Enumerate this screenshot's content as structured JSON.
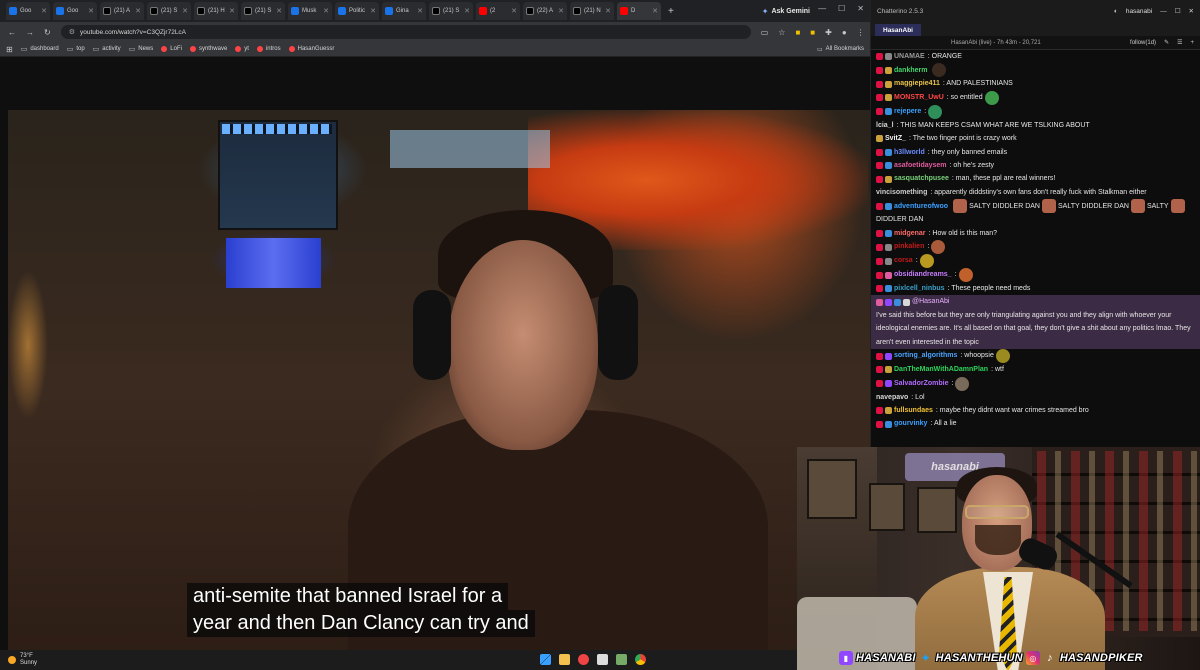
{
  "browser": {
    "tabs": [
      {
        "label": "Goo",
        "icon": "google-icon",
        "active": false
      },
      {
        "label": "Goo",
        "icon": "google-icon",
        "active": false
      },
      {
        "label": "(21) A",
        "icon": "x-icon",
        "active": false
      },
      {
        "label": "(21) S",
        "icon": "x-icon",
        "active": false
      },
      {
        "label": "(21) H",
        "icon": "x-icon",
        "active": false
      },
      {
        "label": "(21) S",
        "icon": "x-icon",
        "active": false
      },
      {
        "label": "Musk",
        "icon": "google-icon",
        "active": false
      },
      {
        "label": "Politic",
        "icon": "news-icon",
        "active": false
      },
      {
        "label": "Gina",
        "icon": "news-icon",
        "active": false
      },
      {
        "label": "(21) S",
        "icon": "x-icon",
        "active": false
      },
      {
        "label": "(2",
        "icon": "youtube-icon",
        "active": false
      },
      {
        "label": "(22) A",
        "icon": "x-icon",
        "active": false
      },
      {
        "label": "(21) N",
        "icon": "x-icon",
        "active": false
      },
      {
        "label": "D",
        "icon": "youtube-icon",
        "active": true
      }
    ],
    "new_tab_label": "+",
    "gemini_label": "Ask Gemini",
    "url": "youtube.com/watch?v=C3QZjr72LcA",
    "bookmarks": [
      {
        "label": "dashboard",
        "icon": "folder-icon"
      },
      {
        "label": "top",
        "icon": "folder-icon"
      },
      {
        "label": "activity",
        "icon": "folder-icon"
      },
      {
        "label": "News",
        "icon": "folder-icon"
      },
      {
        "label": "LoFi",
        "icon": "youtube-icon"
      },
      {
        "label": "synthwave",
        "icon": "youtube-icon"
      },
      {
        "label": "yt",
        "icon": "youtube-icon"
      },
      {
        "label": "intros",
        "icon": "youtube-icon"
      },
      {
        "label": "HasanGuessr",
        "icon": "youtube-icon"
      }
    ],
    "all_bookmarks_label": "All Bookmarks"
  },
  "video": {
    "captions": [
      "anti-semite that banned Israel for a",
      "year and then Dan Clancy can try and"
    ]
  },
  "taskbar": {
    "temperature": "73°F",
    "condition": "Sunny"
  },
  "chatterino": {
    "window_title": "Chatterino 2.5.3",
    "user": "hasanabi",
    "tab_label": "HasanAbi",
    "stream_info": "HasanAbi (live) - 7h 43m - 20,721",
    "follow_label": "follow(1d)",
    "messages": [
      {
        "user": "UNAMAE",
        "color": "#9a9a9a",
        "text": ": ORANGE",
        "badges": [
          "b-red",
          "b-grey"
        ],
        "emotes": []
      },
      {
        "user": "dankherm",
        "color": "#41d66a",
        "text": "",
        "badges": [
          "b-red",
          "b-gold"
        ],
        "emotes": [
          "#3a2a20"
        ]
      },
      {
        "user": "maggiepie411",
        "color": "#e8c44a",
        "text": ": AND PALESTINIANS",
        "badges": [
          "b-red",
          "b-gold"
        ],
        "emotes": []
      },
      {
        "user": "MONSTR_UwU",
        "color": "#ff4545",
        "text": ": so entitled",
        "badges": [
          "b-red",
          "b-gold"
        ],
        "emotes": [
          "#3c9a4a"
        ]
      },
      {
        "user": "rejepere",
        "color": "#3aa0ff",
        "text": ":",
        "badges": [
          "b-red",
          "b-blue"
        ],
        "emotes": [
          "#2f8f5a"
        ]
      },
      {
        "user": "lcia_l",
        "color": "#d8d8d8",
        "text": ": THIS MAN KEEPS CSAM WHAT ARE WE TSLKING ABOUT",
        "badges": [],
        "emotes": []
      },
      {
        "user": "SvitZ_",
        "color": "#f4f4f4",
        "text": ": The two finger point is crazy work",
        "badges": [
          "b-gold"
        ],
        "emotes": []
      },
      {
        "user": "h3llworld",
        "color": "#6b8cff",
        "text": ": they only banned emails",
        "badges": [
          "b-red",
          "b-blue"
        ],
        "emotes": []
      },
      {
        "user": "asafoetidaysem",
        "color": "#e05c9f",
        "text": ": oh he's zesty",
        "badges": [
          "b-red",
          "b-blue"
        ],
        "emotes": []
      },
      {
        "user": "sasquatchpusee",
        "color": "#7ad17a",
        "text": ": man, these ppl are real winners!",
        "badges": [
          "b-red",
          "b-gold"
        ],
        "emotes": []
      },
      {
        "user": "vincisomething",
        "color": "#cfcfcf",
        "text": ": apparently diddstiny's own fans don't really fuck with Stalkman either",
        "badges": [],
        "emotes": []
      }
    ],
    "multi_msg": {
      "user": "adventureofwoo",
      "color": "#3aa0ff",
      "parts": [
        "SALTY DIDDLER DAN",
        "SALTY DIDDLER DAN",
        "SALTY",
        "DIDDLER DAN"
      ]
    },
    "messages2": [
      {
        "user": "midgenar",
        "color": "#ff6a6a",
        "text": ": How old is this man?",
        "badges": [
          "b-red",
          "b-blue"
        ],
        "emotes": []
      },
      {
        "user": "pinkalien",
        "color": "#c41a1a",
        "text": ":",
        "badges": [
          "b-red",
          "b-grey"
        ],
        "emotes": [
          "#a85a3a"
        ]
      },
      {
        "user": "corsa",
        "color": "#c41a1a",
        "text": ":",
        "badges": [
          "b-red",
          "b-grey"
        ],
        "emotes": [
          "#b89a20"
        ]
      },
      {
        "user": "obsidiandreams_",
        "color": "#c77dff",
        "text": ":",
        "badges": [
          "b-red",
          "b-pink"
        ],
        "emotes": [
          "#c0602a"
        ]
      },
      {
        "user": "pixlcell_ninbus",
        "color": "#3ba0c8",
        "text": ": These people need meds",
        "badges": [
          "b-red",
          "b-blue"
        ],
        "emotes": []
      }
    ],
    "highlight_msg": {
      "mention": "@HasanAbi",
      "text": "I've said this before but they are only triangulating against you and they align with whoever your ideological enemies are. It's all based on that goal, they don't give a shit about any politics lmao. They aren't even interested in the topic"
    },
    "messages3": [
      {
        "user": "sorting_algorithms",
        "color": "#4aa3ff",
        "text": ": whoopsie",
        "badges": [
          "b-red",
          "b-purple"
        ],
        "emotes": [
          "#9a8a20"
        ]
      },
      {
        "user": "DanTheManWithADamnPlan",
        "color": "#2ed35a",
        "text": ": wtf",
        "badges": [
          "b-red",
          "b-gold"
        ],
        "emotes": []
      },
      {
        "user": "SalvadorZombie",
        "color": "#b26aff",
        "text": ":",
        "badges": [
          "b-red",
          "b-purple"
        ],
        "emotes": [
          "#7a6a5a"
        ]
      },
      {
        "user": "navepavo",
        "color": "#d8d8d8",
        "text": ": Lol",
        "badges": [],
        "emotes": []
      },
      {
        "user": "fullsundaes",
        "color": "#f1c232",
        "text": ": maybe they didnt want war crimes streamed bro",
        "badges": [
          "b-red",
          "b-gold"
        ],
        "emotes": []
      },
      {
        "user": "gourvinky",
        "color": "#3aa0ff",
        "text": ": All a lie",
        "badges": [
          "b-red",
          "b-blue"
        ],
        "emotes": []
      }
    ]
  },
  "webcam": {
    "sign_text": "hasanabi",
    "socials": [
      {
        "icon": "twitch-icon",
        "handle": "HASANABI"
      },
      {
        "icon": "twitter-icon",
        "handle": "HASANTHEHUN"
      },
      {
        "icon": "instagram-icon",
        "handle": ""
      },
      {
        "icon": "tiktok-icon",
        "handle": "HASANDPIKER"
      }
    ]
  }
}
